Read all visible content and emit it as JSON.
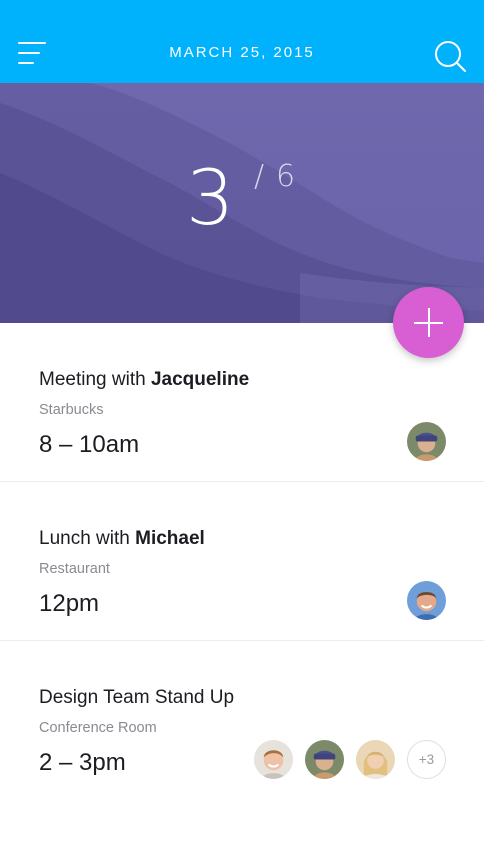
{
  "header": {
    "date": "MARCH 25, 2015",
    "menu_icon": "menu-icon",
    "search_icon": "search-icon",
    "background_color": "#00b2fb"
  },
  "hero": {
    "current": "3",
    "separator": "/",
    "total": "6"
  },
  "fab": {
    "icon": "plus-icon",
    "color": "#d85ed3"
  },
  "events": [
    {
      "title_prefix": "Meeting with ",
      "title_name": "Jacqueline",
      "place": "Starbucks",
      "time": "8 – 10am",
      "attendees": [
        "avatar-woman-beanie"
      ]
    },
    {
      "title_prefix": "Lunch with ",
      "title_name": "Michael",
      "place": "Restaurant",
      "time": "12pm",
      "attendees": [
        "avatar-man-smiling"
      ]
    },
    {
      "title_prefix": "Design Team Stand Up",
      "title_name": "",
      "place": "Conference Room",
      "time": "2 – 3pm",
      "attendees": [
        "avatar-man-blond",
        "avatar-woman-beanie",
        "avatar-woman-blonde"
      ],
      "more_count": "+3"
    }
  ]
}
